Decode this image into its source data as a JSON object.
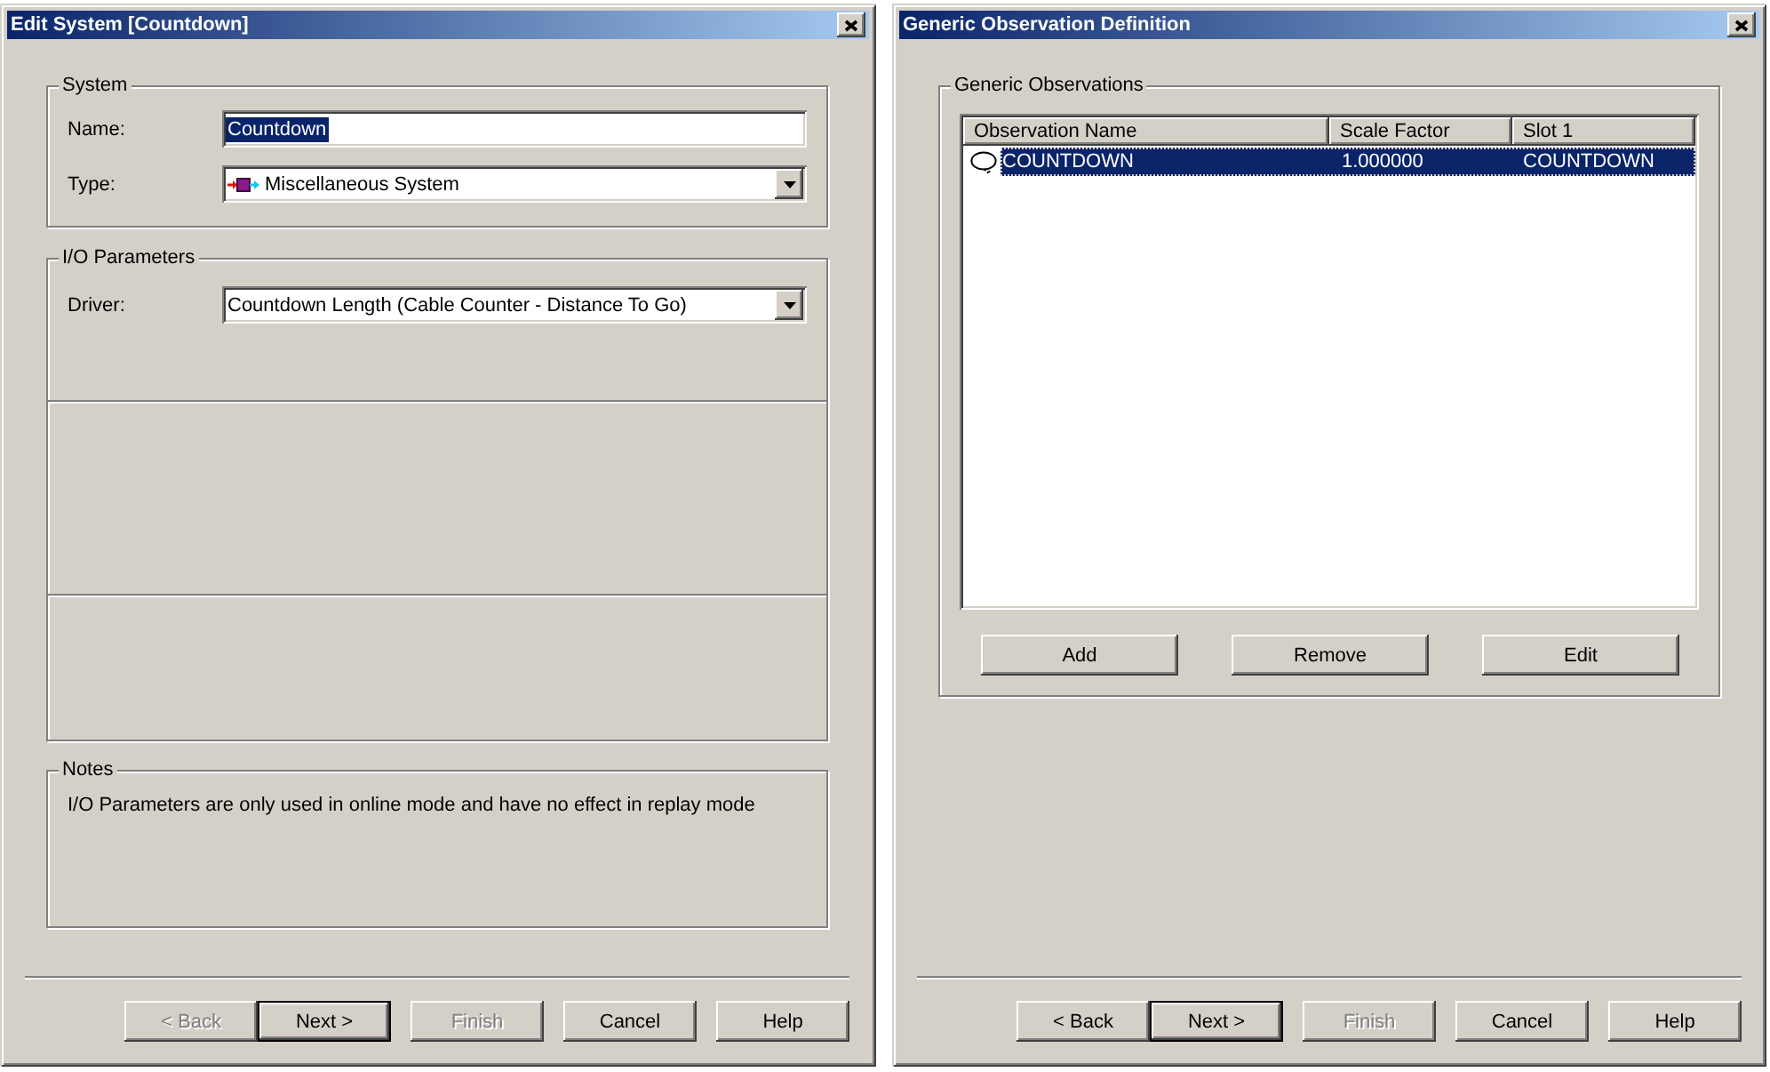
{
  "edit_system_dialog": {
    "title": "Edit System [Countdown]",
    "system_group": {
      "label": "System",
      "fields": [
        {
          "kind": "text",
          "label": "Name:",
          "value": "Countdown",
          "text_selected": true
        },
        {
          "kind": "icon_combo",
          "label": "Type:",
          "value": "Miscellaneous System",
          "text_selected": false
        }
      ]
    },
    "io_group": {
      "label": "I/O Parameters",
      "fields": [
        {
          "kind": "combo",
          "label": "Driver:",
          "value": "Countdown Length (Cable Counter - Distance To Go)",
          "text_selected": false
        }
      ]
    },
    "notes_group": {
      "label": "Notes",
      "text": "I/O Parameters are only used in online mode and have no effect in replay mode"
    },
    "buttons": [
      {
        "label": "< Back",
        "disabled": true,
        "default": false
      },
      {
        "label": "Next >",
        "disabled": false,
        "default": true
      },
      {
        "label": "Finish",
        "disabled": true,
        "default": false
      },
      {
        "label": "Cancel",
        "disabled": false,
        "default": false
      },
      {
        "label": "Help",
        "disabled": false,
        "default": false
      }
    ]
  },
  "observation_dialog": {
    "title": "Generic Observation Definition",
    "group_label": "Generic Observations",
    "list": {
      "columns": [
        "Observation Name",
        "Scale Factor",
        "Slot 1"
      ],
      "rows": [
        {
          "cells": [
            "COUNTDOWN",
            "1.000000",
            "COUNTDOWN"
          ],
          "selected": true
        }
      ]
    },
    "list_buttons": [
      "Add",
      "Remove",
      "Edit"
    ],
    "buttons": [
      {
        "label": "< Back",
        "disabled": false,
        "default": false
      },
      {
        "label": "Next >",
        "disabled": false,
        "default": true
      },
      {
        "label": "Finish",
        "disabled": true,
        "default": false
      },
      {
        "label": "Cancel",
        "disabled": false,
        "default": false
      },
      {
        "label": "Help",
        "disabled": false,
        "default": false
      }
    ]
  }
}
